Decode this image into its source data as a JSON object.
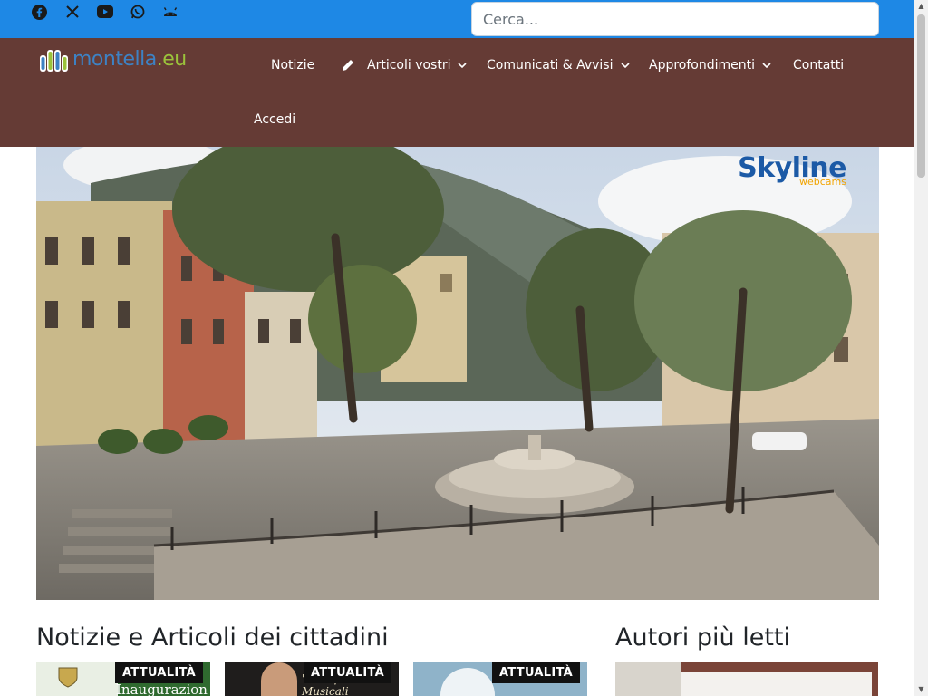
{
  "social": {
    "icons": [
      "facebook-icon",
      "x-icon",
      "youtube-icon",
      "whatsapp-icon",
      "android-icon"
    ]
  },
  "search": {
    "placeholder": "Cerca..."
  },
  "logo": {
    "part1": "montella",
    "part2": ".eu"
  },
  "nav": {
    "items": [
      {
        "label": "Notizie"
      },
      {
        "label": "Articoli vostri"
      },
      {
        "label": "Comunicati & Avvisi"
      },
      {
        "label": "Approfondimenti"
      },
      {
        "label": "Contatti"
      },
      {
        "label": "Accedi"
      }
    ]
  },
  "hero": {
    "watermark_main": "Skyline",
    "watermark_sub": "webcams"
  },
  "sections": {
    "news_title": "Notizie e Articoli dei cittadini",
    "authors_title": "Autori più letti"
  },
  "cards": [
    {
      "badge": "ATTUALITÀ",
      "caption": "Inaugurazion"
    },
    {
      "badge": "ATTUALITÀ",
      "caption": "\"Discipline Musicali"
    },
    {
      "badge": "ATTUALITÀ",
      "caption": ""
    }
  ],
  "colors": {
    "topbar": "#1e88e5",
    "nav": "#653b35",
    "badge": "#111111"
  }
}
